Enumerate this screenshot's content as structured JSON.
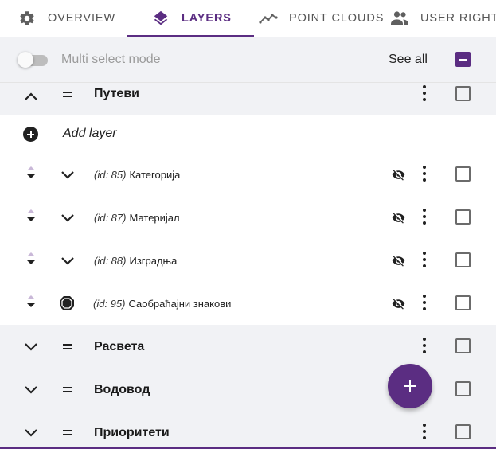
{
  "tabs": [
    {
      "label": "OVERVIEW",
      "icon": "gear-icon",
      "active": false
    },
    {
      "label": "LAYERS",
      "icon": "layers-icon",
      "active": true
    },
    {
      "label": "POINT CLOUDS",
      "icon": "trend-line-icon",
      "active": false
    },
    {
      "label": "USER RIGHTS",
      "icon": "users-icon",
      "active": false
    }
  ],
  "toolbar": {
    "multi_select_label": "Multi select mode",
    "multi_select_on": false,
    "see_all_label": "See all",
    "select_all_state": "indeterminate"
  },
  "groups": [
    {
      "name": "Путеви",
      "expanded": true,
      "add_layer_label": "Add layer",
      "layers": [
        {
          "id_label": "(id: 85)",
          "name": "Категорија",
          "hidden": true
        },
        {
          "id_label": "(id: 87)",
          "name": "Материјал",
          "hidden": true
        },
        {
          "id_label": "(id: 88)",
          "name": "Изградња",
          "hidden": true
        },
        {
          "id_label": "(id: 95)",
          "name": "Саобраћајни знакови",
          "hidden": true,
          "icon": "octagon-icon"
        }
      ]
    },
    {
      "name": "Расвета",
      "expanded": false
    },
    {
      "name": "Водовод",
      "expanded": false
    },
    {
      "name": "Приоритети",
      "expanded": false
    }
  ],
  "colors": {
    "accent": "#5b2d82",
    "group_bg": "#f1f2f5"
  },
  "fab": {
    "icon": "plus-icon"
  }
}
